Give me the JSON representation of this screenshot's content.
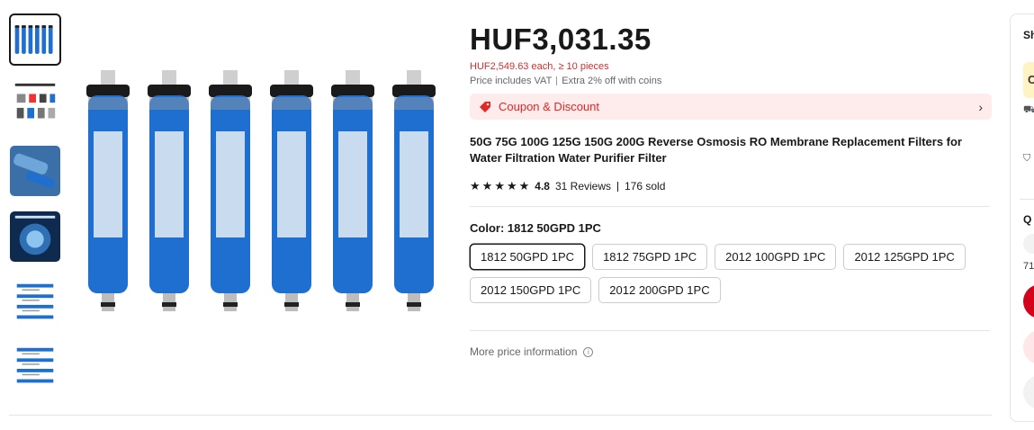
{
  "product": {
    "price": "HUF3,031.35",
    "bulk_price": "HUF2,549.63 each, ≥ 10 pieces",
    "vat_note": "Price includes VAT",
    "coins_note": "Extra 2% off with coins",
    "coupon_label": "Coupon & Discount",
    "coupon_arrow": "›",
    "title": "50G 75G 100G 125G 150G 200G Reverse Osmosis RO Membrane Replacement Filters for Water Filtration Water Purifier Filter",
    "rating": {
      "stars": 5,
      "score": "4.8",
      "reviews": "31 Reviews",
      "sold": "176 sold"
    },
    "color_label": "Color: 1812 50GPD 1PC",
    "options": [
      {
        "label": "1812 50GPD 1PC",
        "selected": true
      },
      {
        "label": "1812 75GPD 1PC",
        "selected": false
      },
      {
        "label": "2012 100GPD 1PC",
        "selected": false
      },
      {
        "label": "2012 125GPD 1PC",
        "selected": false
      },
      {
        "label": "2012 150GPD 1PC",
        "selected": false
      },
      {
        "label": "2012 200GPD 1PC",
        "selected": false
      }
    ],
    "more_price_info": "More price information",
    "info_icon": "i"
  },
  "gallery": {
    "thumbnail_count": 6,
    "active_index": 0,
    "main_filter_count": 6
  },
  "side_panel": {
    "header_initial": "Sh",
    "button_initial": "C",
    "quantity_initial": "Q",
    "stock_initial": "71"
  },
  "colors": {
    "price_red": "#d32f2f",
    "coupon_bg": "#fdeceb",
    "coupon_text": "#e32626",
    "filter_blue": "#1f6fd1",
    "buy_red": "#d3031c"
  }
}
